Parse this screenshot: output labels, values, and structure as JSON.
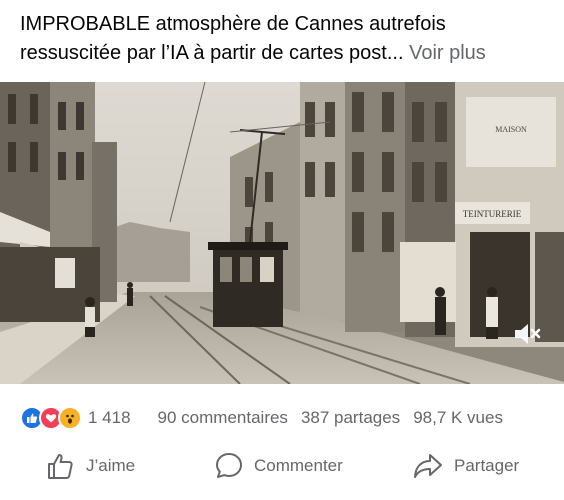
{
  "post": {
    "caption_line1": "IMPROBABLE atmosphère de Cannes autrefois",
    "caption_line2": "ressuscitée par l’IA à partir de cartes post...",
    "see_more": "Voir plus"
  },
  "media": {
    "shop_sign": "TEINTURERIE",
    "facade_sign": "MAISON",
    "mute_icon": "speaker-muted-icon"
  },
  "stats": {
    "reactions": [
      "like",
      "love",
      "wow"
    ],
    "reaction_count": "1 418",
    "comments": "90 commentaires",
    "shares": "387 partages",
    "views": "98,7 K vues"
  },
  "actions": {
    "like": "J’aime",
    "comment": "Commenter",
    "share": "Partager"
  },
  "colors": {
    "like_blue": "#1b74e4",
    "love_red": "#f33e58",
    "wow_yellow": "#f7b125",
    "secondary_text": "#65676b"
  }
}
